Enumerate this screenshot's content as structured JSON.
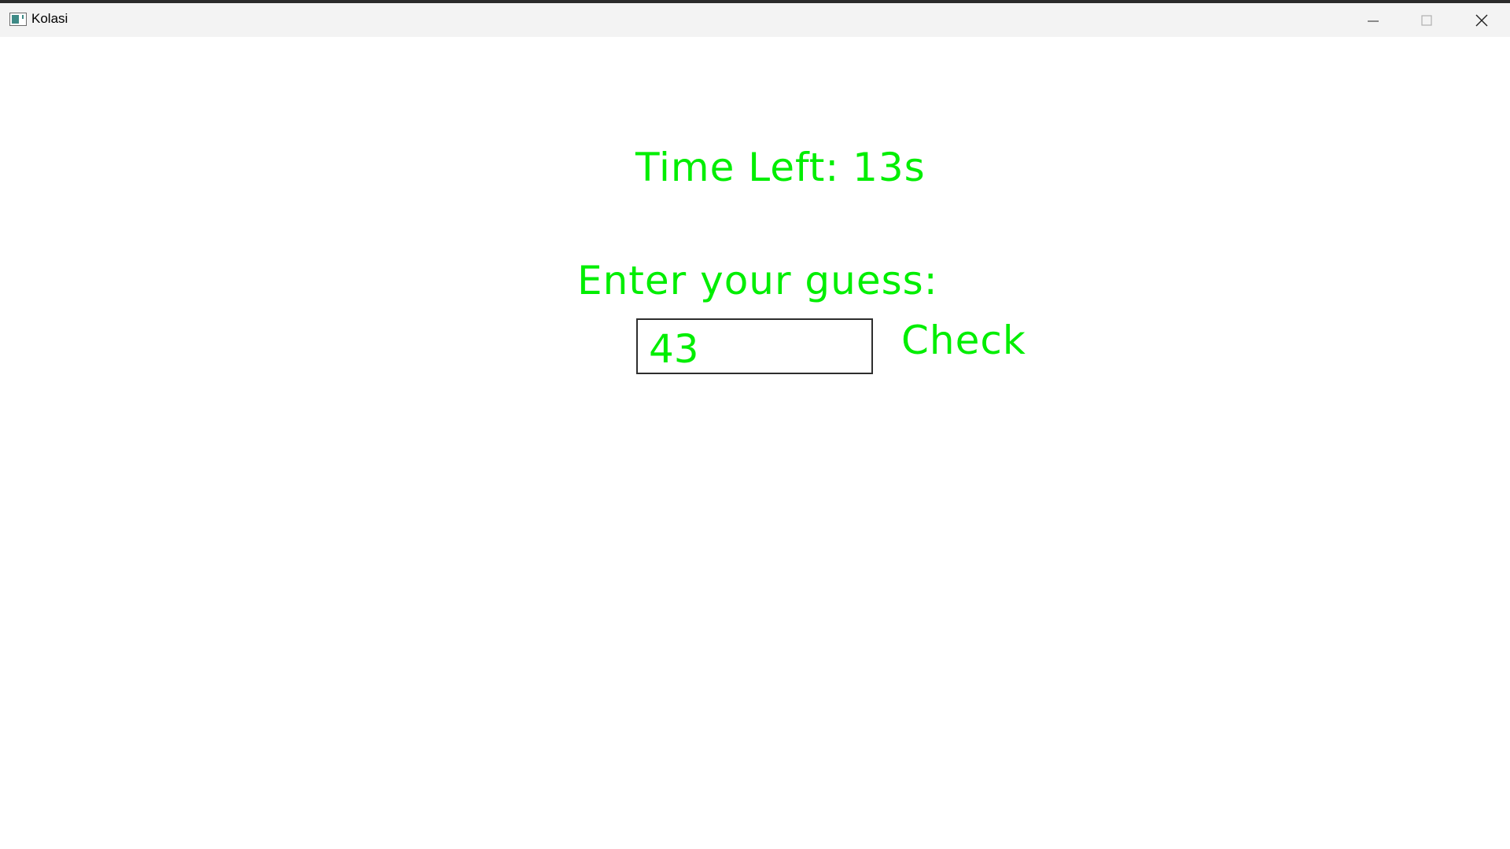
{
  "window": {
    "title": "Kolasi"
  },
  "game": {
    "timer_text": "Time Left: 13s",
    "prompt_text": "Enter your guess:",
    "guess_value": "43",
    "check_label": "Check"
  },
  "colors": {
    "text_accent": "#00ee00",
    "titlebar_bg": "#f3f3f3",
    "background": "#ffffff"
  },
  "icons": {
    "app": "app-window-icon",
    "minimize": "minimize-icon",
    "maximize": "maximize-icon",
    "close": "close-icon"
  }
}
